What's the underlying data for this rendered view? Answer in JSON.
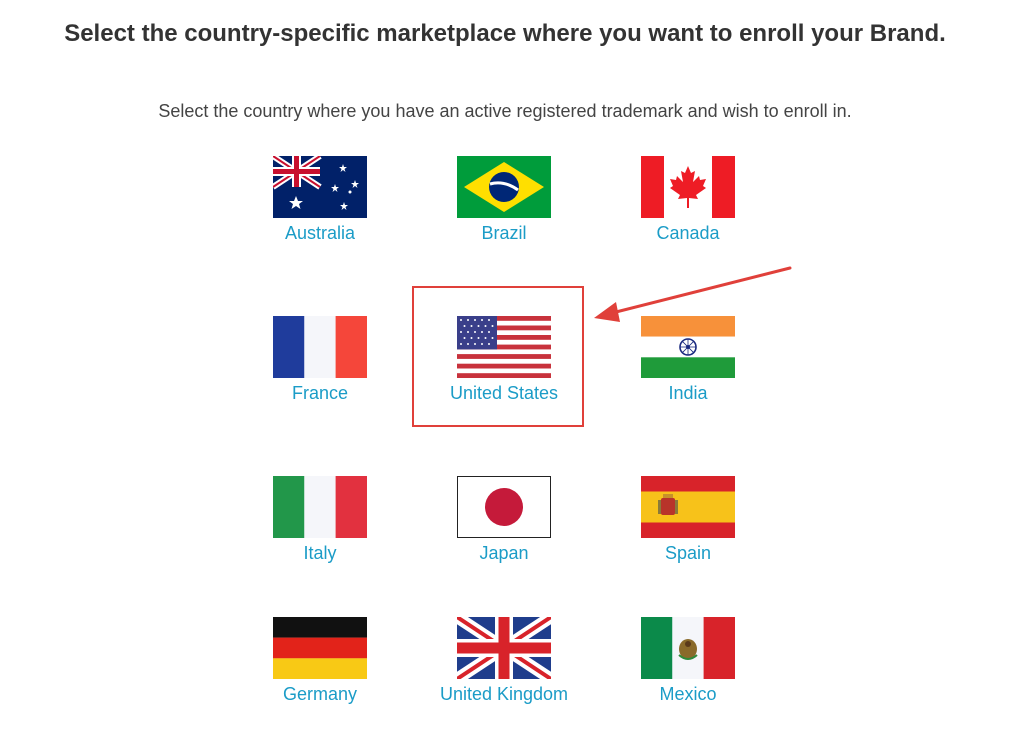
{
  "heading": "Select the country-specific marketplace where you want to enroll your Brand.",
  "instruction": "Select the country where you have an active registered trademark and wish to enroll in.",
  "countries": [
    {
      "label": "Australia",
      "flag": "australia-flag-icon"
    },
    {
      "label": "Brazil",
      "flag": "brazil-flag-icon"
    },
    {
      "label": "Canada",
      "flag": "canada-flag-icon"
    },
    {
      "label": "France",
      "flag": "france-flag-icon"
    },
    {
      "label": "United States",
      "flag": "united-states-flag-icon"
    },
    {
      "label": "India",
      "flag": "india-flag-icon"
    },
    {
      "label": "Italy",
      "flag": "italy-flag-icon"
    },
    {
      "label": "Japan",
      "flag": "japan-flag-icon"
    },
    {
      "label": "Spain",
      "flag": "spain-flag-icon"
    },
    {
      "label": "Germany",
      "flag": "germany-flag-icon"
    },
    {
      "label": "United Kingdom",
      "flag": "united-kingdom-flag-icon"
    },
    {
      "label": "Mexico",
      "flag": "mexico-flag-icon"
    }
  ],
  "highlighted_country": "United States",
  "colors": {
    "link": "#1b9cc7",
    "highlight": "#e0403a",
    "heading": "#333333"
  }
}
